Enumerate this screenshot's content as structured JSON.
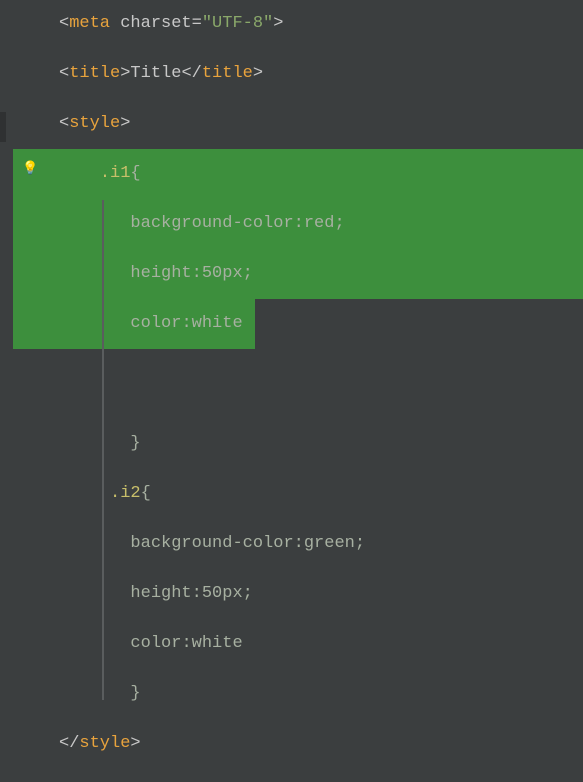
{
  "gutter": {
    "bulb_icon": "💡"
  },
  "lines": {
    "l1": {
      "d1": "<",
      "tag": "meta",
      "sp": " ",
      "attr": "charset",
      "eq": "=",
      "val": "\"UTF-8\"",
      "d2": ">"
    },
    "l2": {
      "d1": "<",
      "tago": "title",
      "d2": ">",
      "txt": "Title",
      "d3": "</",
      "tagc": "title",
      "d4": ">"
    },
    "l3": {
      "d1": "<",
      "tag": "style",
      "d2": ">"
    },
    "l4": {
      "sel": ".i1",
      "br": "{"
    },
    "l5": {
      "prop": "background-color",
      "col": ":",
      "val": "red",
      "sc": ";"
    },
    "l6": {
      "prop": "height",
      "col": ":",
      "val": "50px",
      "sc": ";"
    },
    "l7": {
      "prop": "color",
      "col": ":",
      "val": "white"
    },
    "l8": {
      "br": "}"
    },
    "l9": {
      "sel": ".i2",
      "br": "{"
    },
    "l10": {
      "prop": "background-color",
      "col": ":",
      "val": "green",
      "sc": ";"
    },
    "l11": {
      "prop": "height",
      "col": ":",
      "val": "50px",
      "sc": ";"
    },
    "l12": {
      "prop": "color",
      "col": ":",
      "val": "white"
    },
    "l13": {
      "br": "}"
    },
    "l14": {
      "d1": "</",
      "tag": "style",
      "d2": ">"
    }
  }
}
